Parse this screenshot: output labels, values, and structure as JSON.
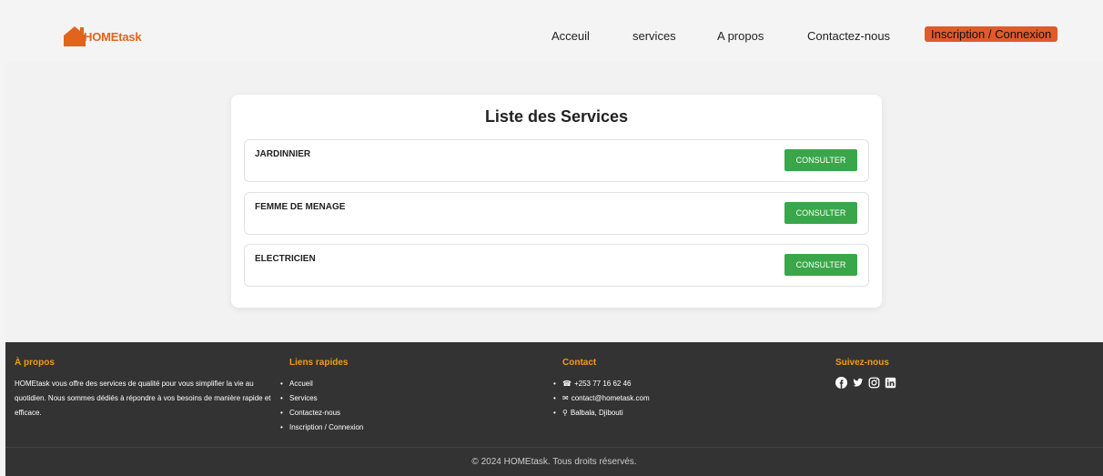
{
  "header": {
    "logo_text": "HOMEtask",
    "nav": [
      {
        "label": "Acceuil"
      },
      {
        "label": "services"
      },
      {
        "label": "A propos"
      },
      {
        "label": "Contactez-nous"
      }
    ],
    "cta_label": "Inscription / Connexion"
  },
  "main": {
    "title": "Liste des Services",
    "services": [
      {
        "name": "JARDINNIER",
        "button": "CONSULTER"
      },
      {
        "name": "FEMME DE MENAGE",
        "button": "CONSULTER"
      },
      {
        "name": "ELECTRICIEN",
        "button": "CONSULTER"
      }
    ]
  },
  "footer": {
    "about": {
      "heading": "À propos",
      "text": "HOMEtask vous offre des services de qualité pour vous simplifier la vie au quotidien. Nous sommes dédiés à répondre à vos besoins de manière rapide et efficace."
    },
    "links": {
      "heading": "Liens rapides",
      "items": [
        "Accueil",
        "Services",
        "Contactez-nous",
        "Inscription / Connexion"
      ]
    },
    "contact": {
      "heading": "Contact",
      "phone": "+253 77 16 62 46",
      "email": "contact@hometask.com",
      "address": "Balbala, Djibouti"
    },
    "social": {
      "heading": "Suivez-nous",
      "icons": [
        "facebook-icon",
        "twitter-icon",
        "instagram-icon",
        "linkedin-icon"
      ]
    },
    "copyright": "© 2024 HOMEtask. Tous droits réservés."
  },
  "colors": {
    "brand": "#e0641e",
    "cta": "#e05a2a",
    "button_green": "#3aa64a",
    "footer_bg": "#333333",
    "footer_heading": "#f39c12"
  }
}
